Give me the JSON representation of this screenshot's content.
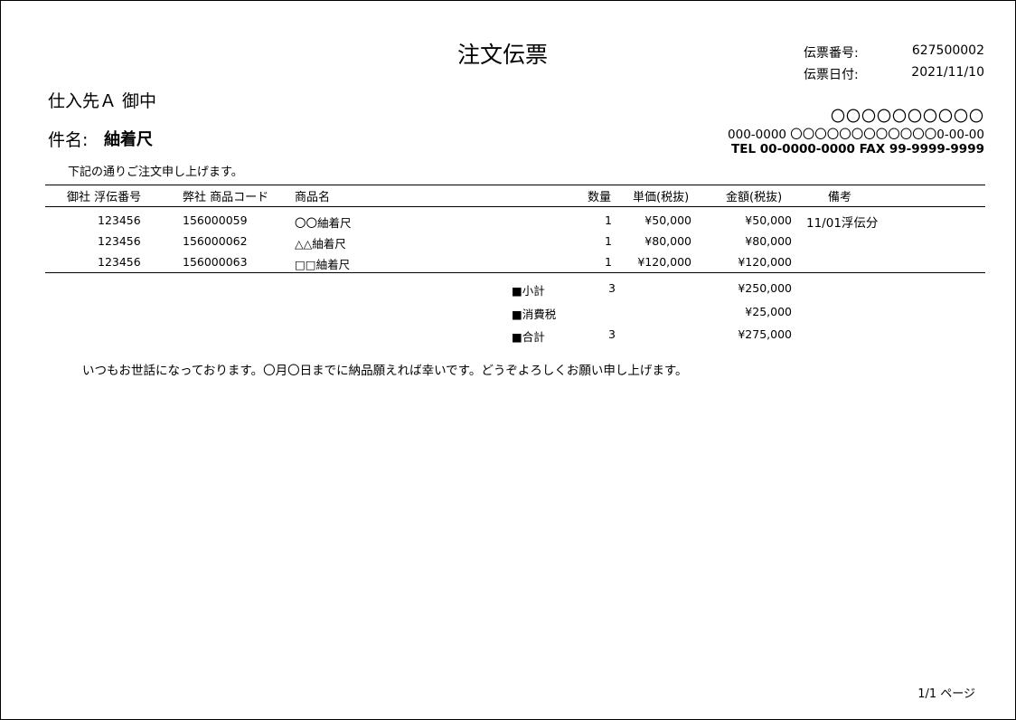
{
  "header": {
    "title": "注文伝票",
    "slip_number_label": "伝票番号:",
    "slip_number": "627500002",
    "slip_date_label": "伝票日付:",
    "slip_date": "2021/11/10"
  },
  "recipient": "仕入先Ａ 御中",
  "subject": {
    "label": "件名:",
    "value": "紬着尺"
  },
  "intro": "下記の通りご注文申し上げます。",
  "company": {
    "name": "〇〇〇〇〇〇〇〇〇〇",
    "address": "000-0000 〇〇〇〇〇〇〇〇〇〇〇〇0-00-00",
    "contact": "TEL 00-0000-0000 FAX 99-9999-9999"
  },
  "table": {
    "headers": [
      "御社 浮伝番号",
      "弊社 商品コード",
      "商品名",
      "数量",
      "単価(税抜)",
      "金額(税抜)",
      "備考"
    ],
    "rows": [
      [
        "123456",
        "156000059",
        "〇〇紬着尺",
        "1",
        "¥50,000",
        "¥50,000",
        "11/01浮伝分"
      ],
      [
        "123456",
        "156000062",
        "△△紬着尺",
        "1",
        "¥80,000",
        "¥80,000",
        ""
      ],
      [
        "123456",
        "156000063",
        "□□紬着尺",
        "1",
        "¥120,000",
        "¥120,000",
        ""
      ]
    ]
  },
  "totals": {
    "subtotal_label": "■小計",
    "subtotal_qty": "3",
    "subtotal_amount": "¥250,000",
    "tax_label": "■消費税",
    "tax_amount": "¥25,000",
    "total_label": "■合計",
    "total_qty": "3",
    "total_amount": "¥275,000"
  },
  "note": "いつもお世話になっております。〇月〇日までに納品願えれば幸いです。どうぞよろしくお願い申し上げます。",
  "footer": {
    "page": "1/1 ページ"
  }
}
